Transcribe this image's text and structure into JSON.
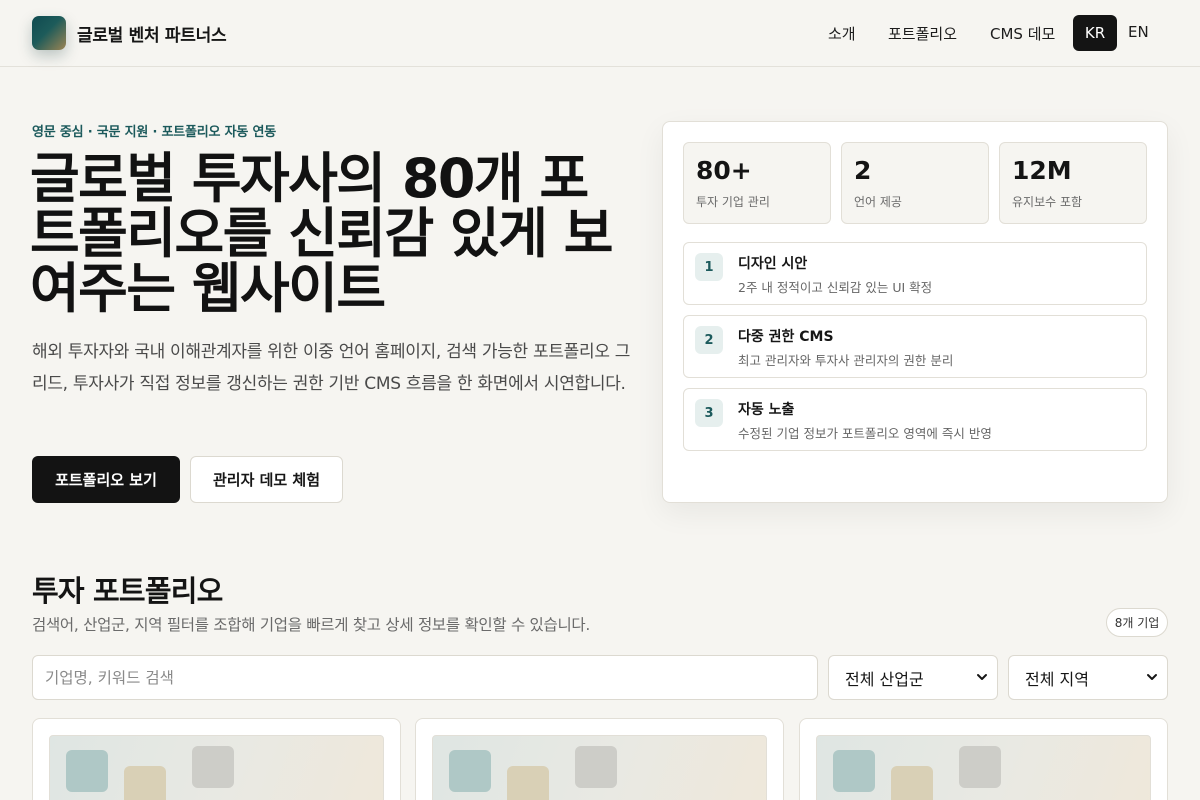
{
  "header": {
    "brand": "글로벌 벤처 파트너스",
    "nav": [
      "소개",
      "포트폴리오",
      "CMS 데모"
    ],
    "lang_active": "KR",
    "lang_other": "EN"
  },
  "hero": {
    "eyebrow": "영문 중심 · 국문 지원 · 포트폴리오 자동 연동",
    "title": "글로벌 투자사의 80개 포트폴리오를 신뢰감 있게 보여주는 웹사이트",
    "description": "해외 투자자와 국내 이해관계자를 위한 이중 언어 홈페이지, 검색 가능한 포트폴리오 그리드, 투자사가 직접 정보를 갱신하는 권한 기반 CMS 흐름을 한 화면에서 시연합니다.",
    "primary_button": "포트폴리오 보기",
    "secondary_button": "관리자 데모 체험"
  },
  "stats": [
    {
      "value": "80+",
      "label": "투자 기업 관리"
    },
    {
      "value": "2",
      "label": "언어 제공"
    },
    {
      "value": "12M",
      "label": "유지보수 포함"
    }
  ],
  "steps": [
    {
      "num": "1",
      "title": "디자인 시안",
      "desc": "2주 내 정적이고 신뢰감 있는 UI 확정"
    },
    {
      "num": "2",
      "title": "다중 권한 CMS",
      "desc": "최고 관리자와 투자사 관리자의 권한 분리"
    },
    {
      "num": "3",
      "title": "자동 노출",
      "desc": "수정된 기업 정보가 포트폴리오 영역에 즉시 반영"
    }
  ],
  "portfolio": {
    "title": "투자 포트폴리오",
    "description": "검색어, 산업군, 지역 필터를 조합해 기업을 빠르게 찾고 상세 정보를 확인할 수 있습니다.",
    "count": "8개 기업",
    "search_placeholder": "기업명, 키워드 검색",
    "industry_selected": "전체 산업군",
    "region_selected": "전체 지역"
  },
  "colors": {
    "accent": "#1c5a5c",
    "dark": "#131313",
    "background": "#f6f5f1"
  },
  "icons": {
    "logo": "brand-logo-icon",
    "select_arrow": "chevron-down-icon"
  }
}
